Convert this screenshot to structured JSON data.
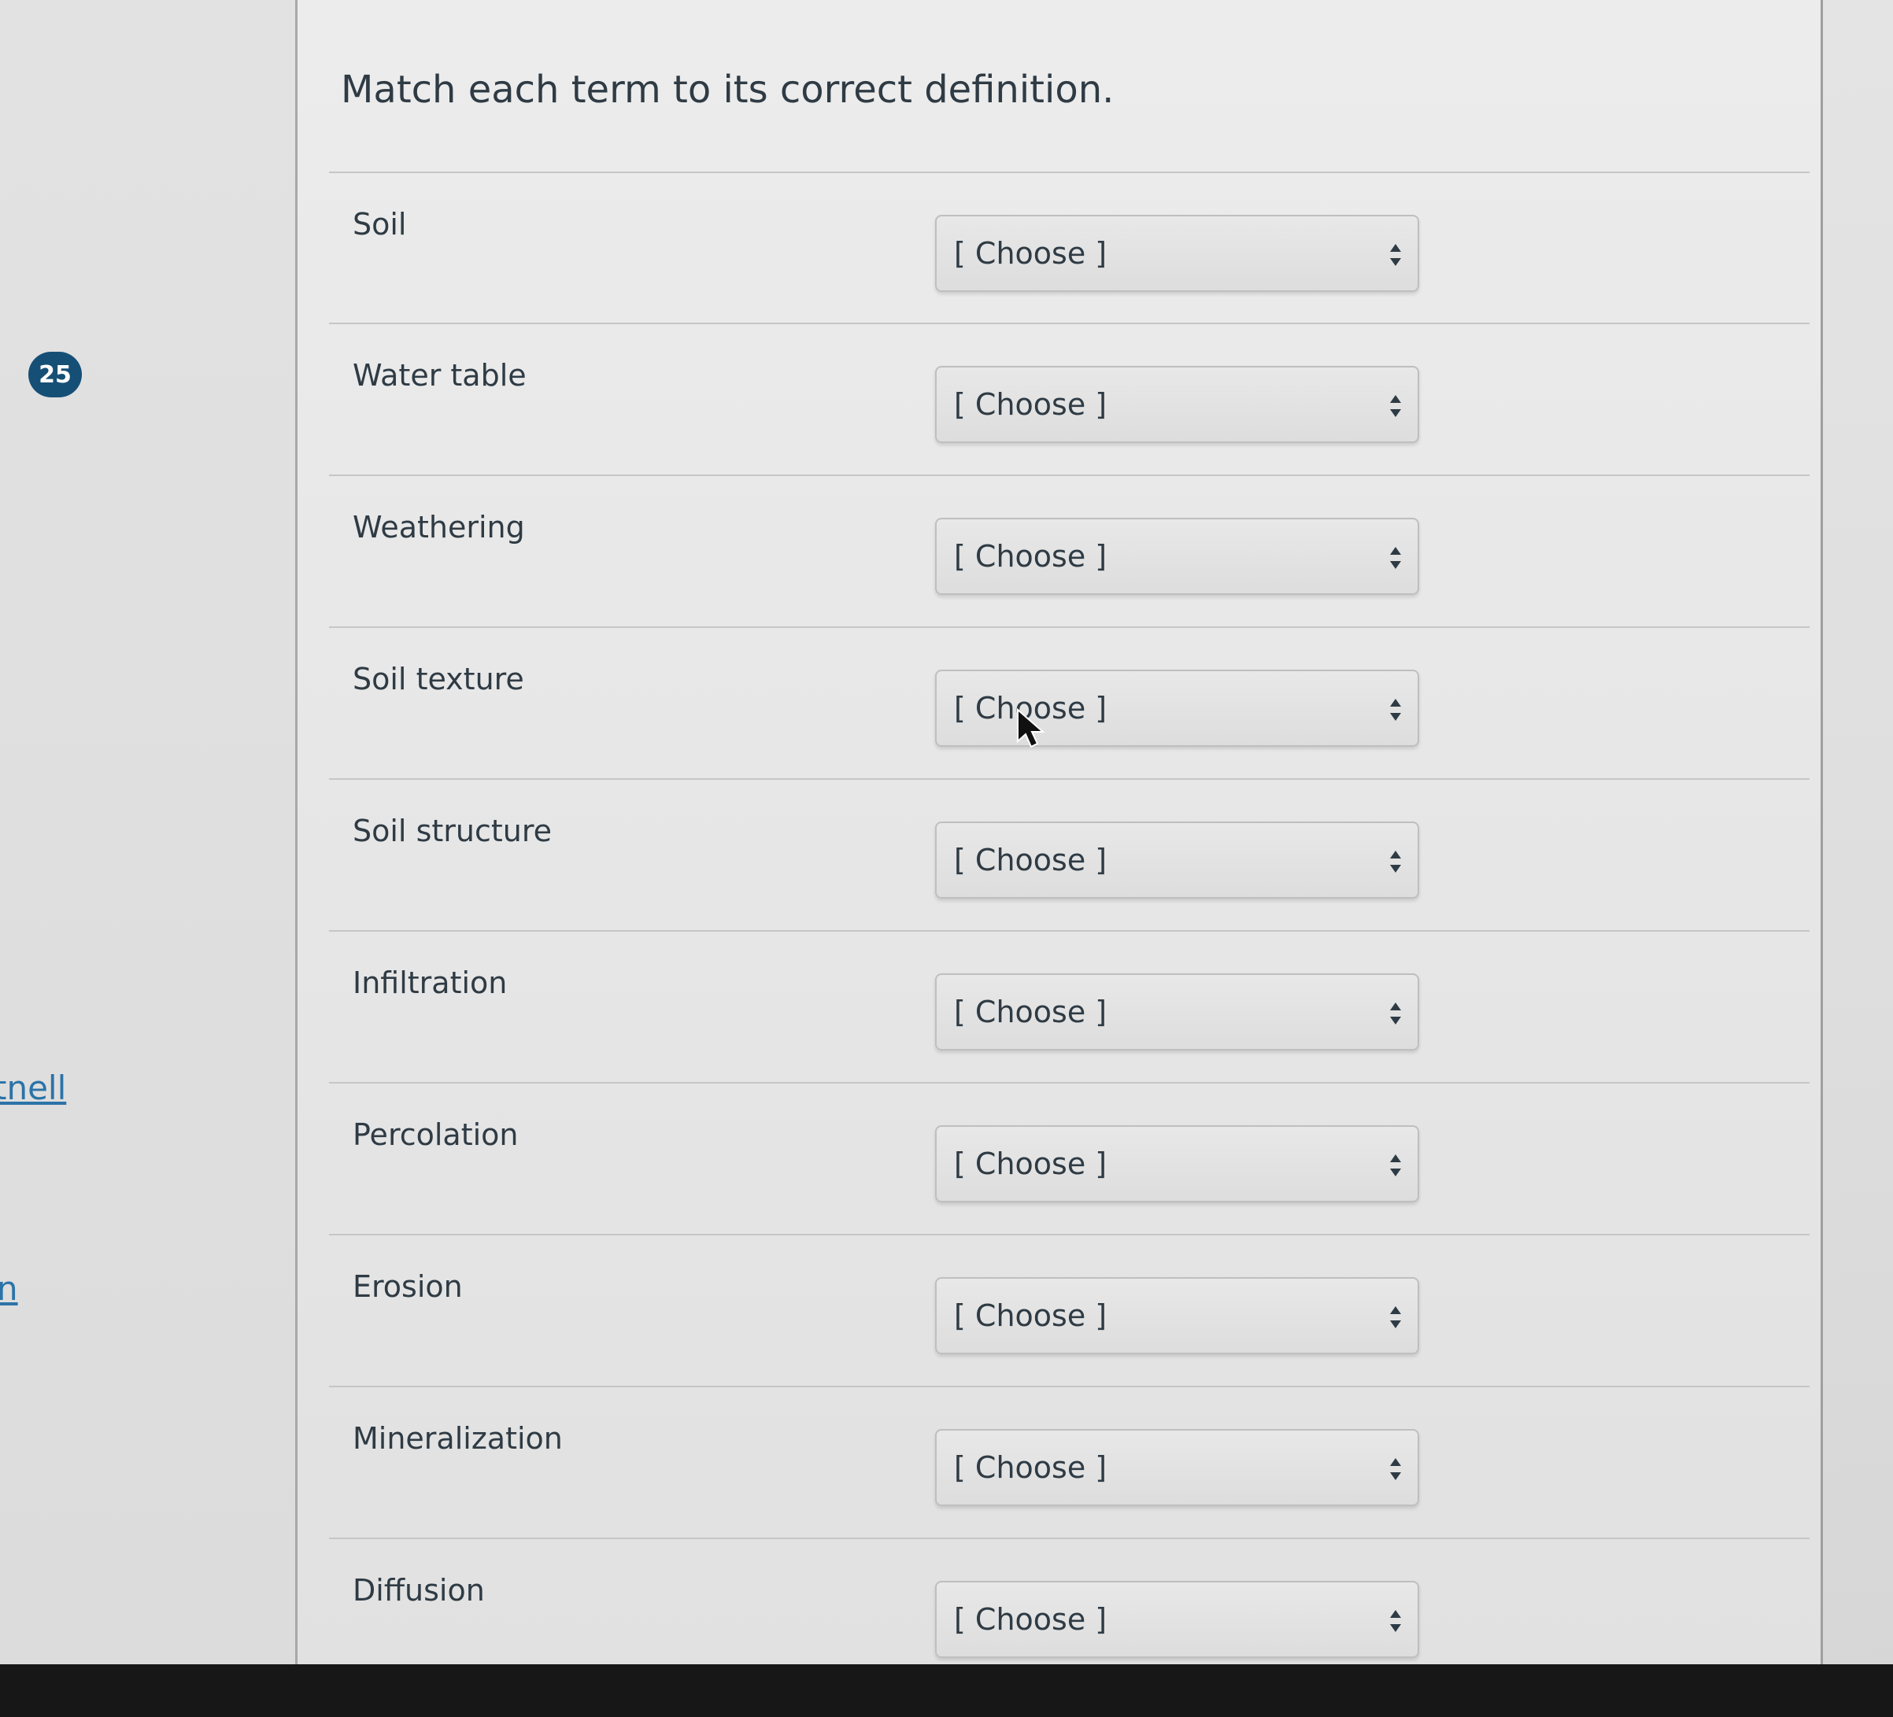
{
  "question": {
    "title": "Match each term to its correct definition.",
    "number_badge": "25"
  },
  "sidebar": {
    "links": [
      {
        "label": "tnell"
      },
      {
        "label": "n"
      }
    ]
  },
  "rows": [
    {
      "term": "Soil",
      "selected": "[ Choose ]"
    },
    {
      "term": "Water table",
      "selected": "[ Choose ]"
    },
    {
      "term": "Weathering",
      "selected": "[ Choose ]"
    },
    {
      "term": "Soil texture",
      "selected": "[ Choose ]"
    },
    {
      "term": "Soil structure",
      "selected": "[ Choose ]"
    },
    {
      "term": "Infiltration",
      "selected": "[ Choose ]"
    },
    {
      "term": "Percolation",
      "selected": "[ Choose ]"
    },
    {
      "term": "Erosion",
      "selected": "[ Choose ]"
    },
    {
      "term": "Mineralization",
      "selected": "[ Choose ]"
    },
    {
      "term": "Diffusion",
      "selected": "[ Choose ]"
    }
  ],
  "icons": {
    "select_arrow": "sort-arrows-icon",
    "mouse_cursor": "mouse-pointer-icon"
  },
  "colors": {
    "badge": "#164f76",
    "link": "#2b73a8",
    "text": "#2f3b44"
  }
}
